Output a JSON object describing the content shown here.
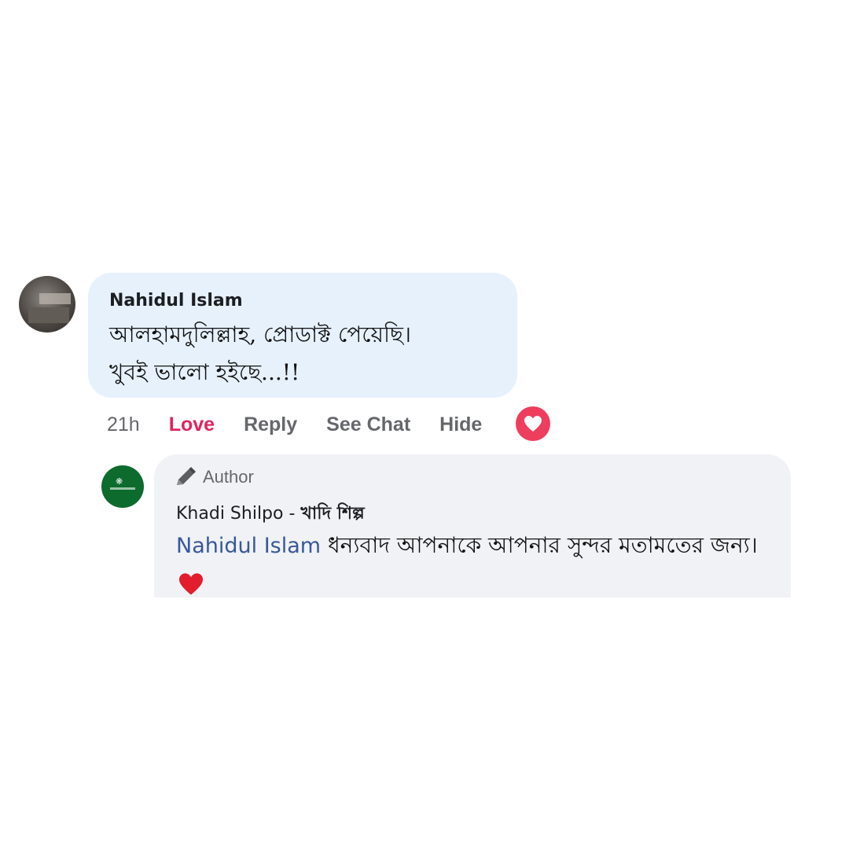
{
  "comment": {
    "author": "Nahidul Islam",
    "text_line1": "আলহামদুলিল্লাহ, প্রোডাক্ট পেয়েছি।",
    "text_line2": "খুবই ভালো হইছে...!!",
    "actions": {
      "time": "21h",
      "love": "Love",
      "reply": "Reply",
      "see_chat": "See Chat",
      "hide": "Hide"
    },
    "reaction_icon": "love-heart",
    "love_color": "#e0245e"
  },
  "reply": {
    "badge": "Author",
    "badge_icon": "pencil-icon",
    "page_name_latin": "Khadi Shilpo - ",
    "page_name_bengali": "খাদি শিল্প",
    "mention": "Nahidul Islam",
    "text": " ধন্যবাদ আপনাকে আপনার সুন্দর মতামতের জন্য।",
    "emoji": "red-heart"
  },
  "colors": {
    "comment_bubble": "#e6f1fc",
    "reply_bubble": "#f0f2f5",
    "mention": "#385898",
    "page_avatar": "#0d6b2e"
  }
}
